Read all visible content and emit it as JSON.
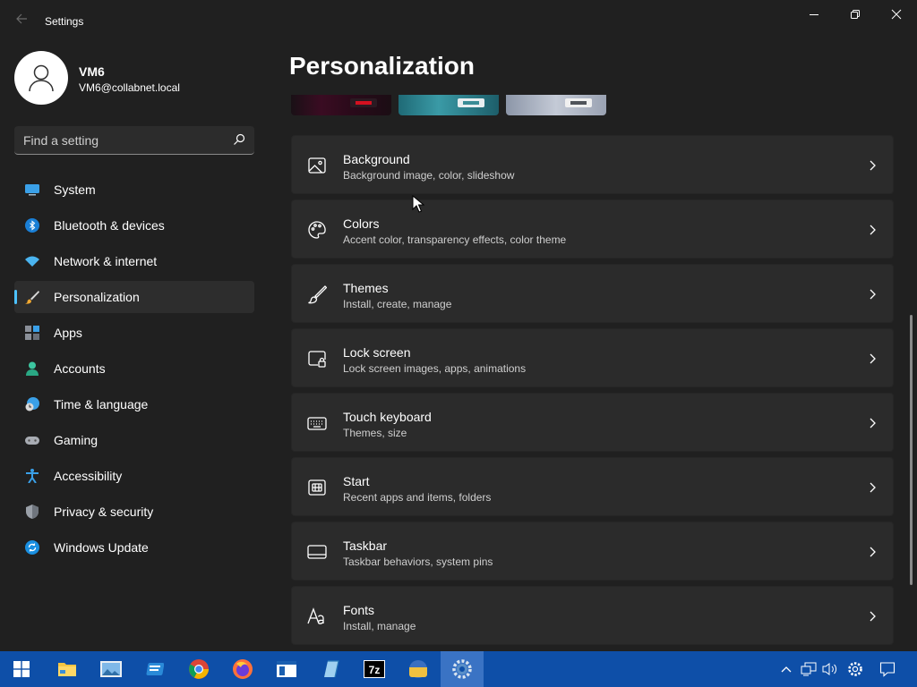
{
  "window": {
    "app_title": "Settings",
    "back_icon": "back-arrow-icon",
    "controls": [
      "minimize-icon",
      "restore-icon",
      "close-icon"
    ]
  },
  "profile": {
    "name": "VM6",
    "email": "VM6@collabnet.local"
  },
  "search": {
    "placeholder": "Find a setting",
    "value": ""
  },
  "sidebar": {
    "items": [
      {
        "label": "System",
        "icon": "system-icon",
        "active": false
      },
      {
        "label": "Bluetooth & devices",
        "icon": "bluetooth-icon",
        "active": false
      },
      {
        "label": "Network & internet",
        "icon": "wifi-icon",
        "active": false
      },
      {
        "label": "Personalization",
        "icon": "brush-icon",
        "active": true
      },
      {
        "label": "Apps",
        "icon": "apps-icon",
        "active": false
      },
      {
        "label": "Accounts",
        "icon": "accounts-icon",
        "active": false
      },
      {
        "label": "Time & language",
        "icon": "clock-globe-icon",
        "active": false
      },
      {
        "label": "Gaming",
        "icon": "gamepad-icon",
        "active": false
      },
      {
        "label": "Accessibility",
        "icon": "accessibility-icon",
        "active": false
      },
      {
        "label": "Privacy & security",
        "icon": "shield-icon",
        "active": false
      },
      {
        "label": "Windows Update",
        "icon": "update-icon",
        "active": false
      }
    ]
  },
  "main": {
    "title": "Personalization",
    "cards": [
      {
        "title": "Background",
        "subtitle": "Background image, color, slideshow",
        "icon": "image-icon"
      },
      {
        "title": "Colors",
        "subtitle": "Accent color, transparency effects, color theme",
        "icon": "palette-icon"
      },
      {
        "title": "Themes",
        "subtitle": "Install, create, manage",
        "icon": "brush-icon"
      },
      {
        "title": "Lock screen",
        "subtitle": "Lock screen images, apps, animations",
        "icon": "lock-screen-icon"
      },
      {
        "title": "Touch keyboard",
        "subtitle": "Themes, size",
        "icon": "keyboard-icon"
      },
      {
        "title": "Start",
        "subtitle": "Recent apps and items, folders",
        "icon": "start-icon"
      },
      {
        "title": "Taskbar",
        "subtitle": "Taskbar behaviors, system pins",
        "icon": "taskbar-icon"
      },
      {
        "title": "Fonts",
        "subtitle": "Install, manage",
        "icon": "fonts-icon"
      }
    ]
  },
  "taskbar": {
    "apps": [
      "windows-start-icon",
      "file-explorer-icon",
      "image-viewer-icon",
      "notepad-icon",
      "chrome-icon",
      "firefox-icon",
      "document-app-icon",
      "editor-app-icon",
      "7zip-icon",
      "folder-app-icon",
      "settings-icon"
    ],
    "tray": [
      "chevron-up-icon",
      "network-icon",
      "volume-icon",
      "gear-icon",
      "notification-icon"
    ]
  },
  "colors": {
    "accent": "#4cc2ff",
    "taskbar": "#0e4fa8",
    "background": "#202020",
    "card": "#2b2b2b"
  }
}
